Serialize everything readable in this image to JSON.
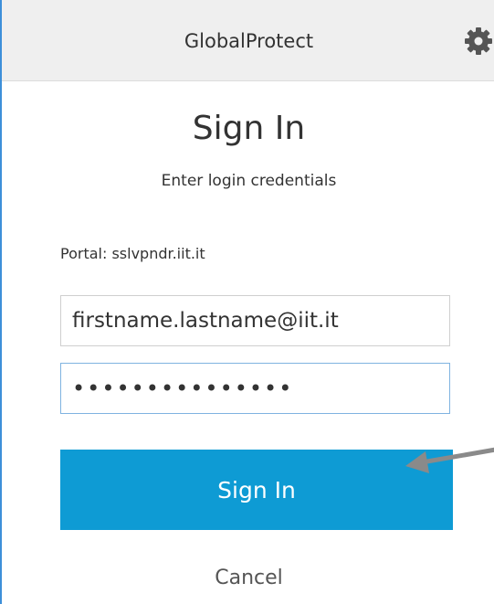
{
  "app": {
    "title": "GlobalProtect"
  },
  "icons": {
    "settings": "gear-icon",
    "annotation": "arrow-icon"
  },
  "signin": {
    "heading": "Sign In",
    "subheading": "Enter login credentials",
    "portal": "Portal: sslvpndr.iit.it",
    "username": "firstname.lastname@iit.it",
    "password": "•••••••••••••••",
    "button_label": "Sign In",
    "cancel_label": "Cancel"
  },
  "colors": {
    "accent": "#0e9bd4",
    "window_border": "#3d8fd9",
    "titlebar": "#efefef"
  }
}
